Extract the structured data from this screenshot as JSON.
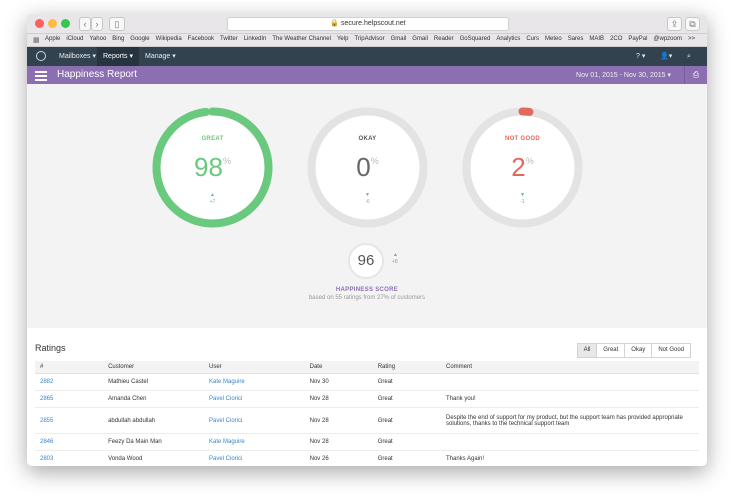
{
  "browser": {
    "address": "secure.helpscout.net",
    "bookmarks": [
      "Apple",
      "iCloud",
      "Yahoo",
      "Bing",
      "Google",
      "Wikipedia",
      "Facebook",
      "Twitter",
      "LinkedIn",
      "The Weather Channel",
      "Yelp",
      "TripAdvisor",
      "Gmail",
      "Gmail",
      "Reader",
      "GoSquared",
      "Analytics",
      "Curs",
      "Meteo",
      "Sares",
      "MAIB",
      "2CO",
      "PayPal",
      "@wpzoom"
    ],
    "more": ">>"
  },
  "nav": {
    "mailboxes": "Mailboxes ▾",
    "reports": "Reports ▾",
    "manage": "Manage ▾",
    "help": "? ▾",
    "user": "▾"
  },
  "report": {
    "title": "Happiness Report",
    "date_range": "Nov 01, 2015 - Nov 30, 2015 ▾"
  },
  "gauges": [
    {
      "label": "GREAT",
      "value": "98",
      "unit": "%",
      "delta": "+7",
      "fraction": 0.98,
      "color": "#69c97d",
      "arrow": "▲"
    },
    {
      "label": "OKAY",
      "value": "0",
      "unit": "%",
      "delta": "-6",
      "fraction": 0.0,
      "color": "#666666",
      "arrow": "▼"
    },
    {
      "label": "NOT GOOD",
      "value": "2",
      "unit": "%",
      "delta": "-1",
      "fraction": 0.02,
      "color": "#e06a5c",
      "arrow": "▼"
    }
  ],
  "score": {
    "value": "96",
    "delta": "+8",
    "title": "HAPPINESS SCORE",
    "subtitle": "based on 55 ratings from 27% of customers"
  },
  "ratings": {
    "title": "Ratings",
    "filters": [
      "All",
      "Great",
      "Okay",
      "Not Good"
    ],
    "columns": [
      "#",
      "Customer",
      "User",
      "Date",
      "Rating",
      "Comment"
    ],
    "rows": [
      {
        "id": "2882",
        "customer": "Mathieu Castel",
        "user": "Kate Maguire",
        "date": "Nov 30",
        "rating": "Great",
        "comment": ""
      },
      {
        "id": "2865",
        "customer": "Amanda Chen",
        "user": "Pavel Ciorici",
        "date": "Nov 28",
        "rating": "Great",
        "comment": "Thank you!"
      },
      {
        "id": "2855",
        "customer": "abdullah abdullah",
        "user": "Pavel Ciorici",
        "date": "Nov 28",
        "rating": "Great",
        "comment": "Despite the end of support for my product, but the support team has provided appropriate solutions, thanks to the technical support team"
      },
      {
        "id": "2846",
        "customer": "Feezy Da Main Man",
        "user": "Kate Maguire",
        "date": "Nov 28",
        "rating": "Great",
        "comment": ""
      },
      {
        "id": "2803",
        "customer": "Vonda Wood",
        "user": "Pavel Ciorici",
        "date": "Nov 26",
        "rating": "Great",
        "comment": "Thanks Again!"
      }
    ]
  }
}
